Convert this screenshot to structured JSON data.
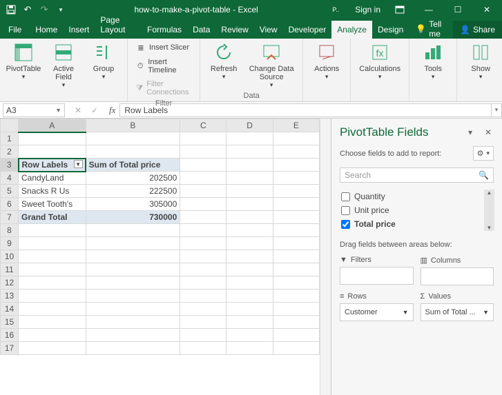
{
  "titlebar": {
    "title": "how-to-make-a-pivot-table - Excel",
    "signin": "Sign in"
  },
  "tabs": {
    "file": "File",
    "list": [
      "Home",
      "Insert",
      "Page Layout",
      "Formulas",
      "Data",
      "Review",
      "View",
      "Developer",
      "Analyze",
      "Design"
    ],
    "active": "Analyze",
    "tellme": "Tell me",
    "share": "Share"
  },
  "ribbon": {
    "group1": {
      "pivottable": "PivotTable",
      "activefield": "Active Field",
      "group": "Group"
    },
    "filter": {
      "slicer": "Insert Slicer",
      "timeline": "Insert Timeline",
      "filterconn": "Filter Connections",
      "label": "Filter"
    },
    "data": {
      "refresh": "Refresh",
      "changedata": "Change Data Source",
      "label": "Data"
    },
    "actions": "Actions",
    "calculations": "Calculations",
    "tools": "Tools",
    "show": "Show"
  },
  "formulabar": {
    "namebox": "A3",
    "fx": "fx",
    "value": "Row Labels"
  },
  "sheet": {
    "cols": [
      "A",
      "B",
      "C",
      "D",
      "E"
    ],
    "rows": [
      1,
      2,
      3,
      4,
      5,
      6,
      7,
      8,
      9,
      10,
      11,
      12,
      13,
      14,
      15,
      16,
      17
    ],
    "headerA": "Row Labels",
    "headerB": "Sum of Total price",
    "data": [
      {
        "label": "CandyLand",
        "value": "202500"
      },
      {
        "label": "Snacks R Us",
        "value": "222500"
      },
      {
        "label": "Sweet Tooth's",
        "value": "305000"
      }
    ],
    "grand": {
      "label": "Grand Total",
      "value": "730000"
    }
  },
  "pane": {
    "title": "PivotTable Fields",
    "subtitle": "Choose fields to add to report:",
    "search_placeholder": "Search",
    "fields": [
      {
        "name": "Quantity",
        "checked": false
      },
      {
        "name": "Unit price",
        "checked": false
      },
      {
        "name": "Total price",
        "checked": true
      }
    ],
    "drag_label": "Drag fields between areas below:",
    "filters": "Filters",
    "columns": "Columns",
    "rows": "Rows",
    "values": "Values",
    "rows_val": "Customer",
    "values_val": "Sum of Total ..."
  },
  "chart_data": {
    "type": "table",
    "title": "Sum of Total price by Customer",
    "categories": [
      "CandyLand",
      "Snacks R Us",
      "Sweet Tooth's"
    ],
    "values": [
      202500,
      222500,
      305000
    ],
    "grand_total": 730000
  }
}
